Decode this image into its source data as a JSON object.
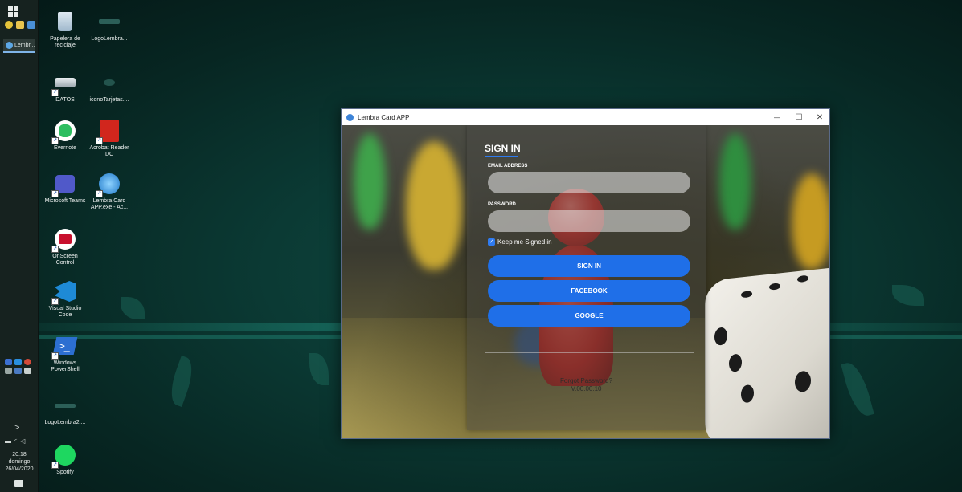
{
  "taskbar": {
    "app_label": "Lembr...",
    "clock_time": "20:18",
    "clock_day": "domingo",
    "clock_date": "26/04/2020"
  },
  "desktop": {
    "icons": [
      {
        "label": "Papelera de reciclaje",
        "icon": "recycle-bin-icon"
      },
      {
        "label": "LogoLembra...",
        "icon": "image-file-icon"
      },
      {
        "label": "DATOS",
        "icon": "drive-icon"
      },
      {
        "label": "iconoTarjetas....",
        "icon": "image-file-icon"
      },
      {
        "label": "Evernote",
        "icon": "evernote-icon"
      },
      {
        "label": "Acrobat Reader DC",
        "icon": "acrobat-icon"
      },
      {
        "label": "Microsoft Teams",
        "icon": "teams-icon"
      },
      {
        "label": "Lembra Card APP.exe - Ac...",
        "icon": "lembra-app-icon"
      },
      {
        "label": "OnScreen Control",
        "icon": "onscreen-control-icon"
      },
      {
        "label": "Visual Studio Code",
        "icon": "vscode-icon"
      },
      {
        "label": "Windows PowerShell",
        "icon": "powershell-icon"
      },
      {
        "label": "LogoLembra2....",
        "icon": "image-file-icon"
      },
      {
        "label": "Spotify",
        "icon": "spotify-icon"
      }
    ]
  },
  "window": {
    "title": "Lembra Card APP",
    "minimize": "—",
    "maximize": "☐",
    "close": "✕"
  },
  "login": {
    "heading": "SIGN IN",
    "email_label": "EMAIL ADDRESS",
    "email_value": "",
    "password_label": "PASSWORD",
    "password_value": "",
    "keep_signed_in": "Keep me Signed in",
    "keep_checked": true,
    "signin_button": "SIGN IN",
    "facebook_button": "FACEBOOK",
    "google_button": "GOOGLE",
    "forgot_password": "Forgot Password?",
    "version": "V.00.00.10"
  },
  "colors": {
    "accent": "#1f6fe8",
    "taskbar": "#16221f",
    "wallpaper": "#0b3a34"
  }
}
